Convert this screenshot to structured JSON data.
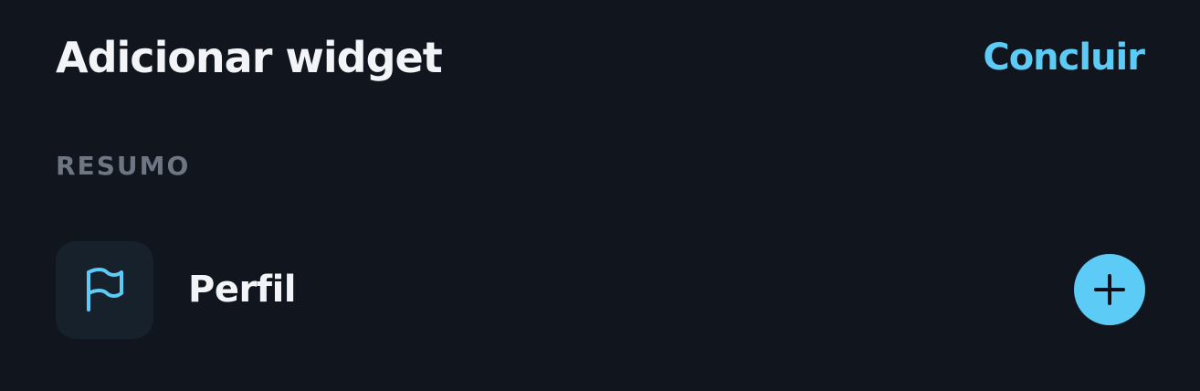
{
  "header": {
    "title": "Adicionar widget",
    "done_label": "Concluir"
  },
  "section": {
    "label": "RESUMO"
  },
  "widgets": [
    {
      "label": "Perfil",
      "icon": "flag-icon",
      "action_icon": "plus-icon"
    }
  ],
  "colors": {
    "background": "#11151e",
    "accent": "#5ccbf5",
    "title_text": "#f2f4f8",
    "section_label": "#6e7683",
    "icon_tile": "#16212c"
  }
}
